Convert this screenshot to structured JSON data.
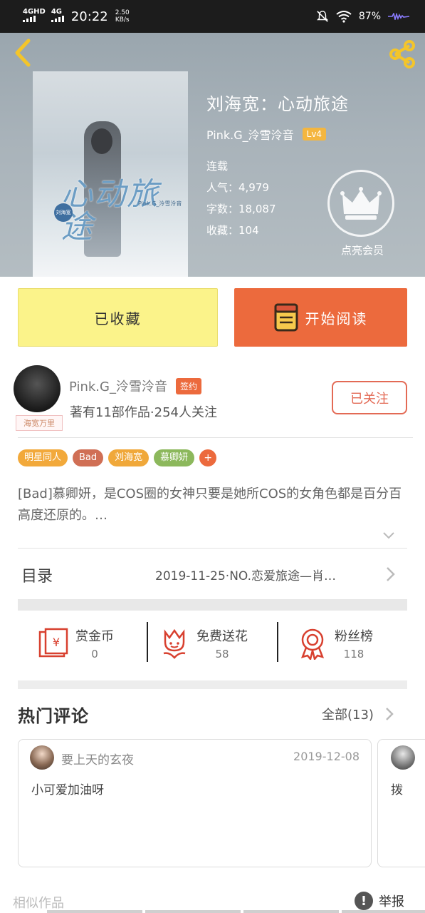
{
  "status_bar": {
    "signal1": "4GHD",
    "signal2": "4G",
    "time": "20:22",
    "net_speed_value": "2.50",
    "net_speed_unit": "KB/s",
    "battery": "87%"
  },
  "book": {
    "title": "刘海宽：心动旅途",
    "author": "Pink.G_泠雪泠音",
    "level": "Lv4",
    "status": "连载",
    "popularity": "人气：4,979",
    "word_count": "字数：18,087",
    "favorites": "收藏：104",
    "vip_label": "点亮会员",
    "cover_title": "心动旅途",
    "cover_author": "Pink.G_泠雪泠音",
    "cover_seal": "刘海宽"
  },
  "actions": {
    "collected_label": "已收藏",
    "read_label": "开始阅读"
  },
  "author_info": {
    "name": "Pink.G_泠雪泠音",
    "sign_badge": "签约",
    "subtitle": "著有11部作品·254人关注",
    "follow_label": "已关注",
    "avatar_tag": "海宽万里"
  },
  "tags": [
    {
      "label": "明星同人",
      "color": "#f2a93b"
    },
    {
      "label": "Bad",
      "color": "#d06f55"
    },
    {
      "label": "刘海宽",
      "color": "#f0a83a"
    },
    {
      "label": "慕卿妍",
      "color": "#8cb85c"
    }
  ],
  "tag_plus": "+",
  "synopsis": "[Bad]慕卿妍，是COS圈的女神只要是她所COS的女角色都是百分百高度还原的。…",
  "toc": {
    "label": "目录",
    "latest": "2019-11-25·NO.恋爱旅途—肖…"
  },
  "stats": [
    {
      "label": "赏金币",
      "value": "0"
    },
    {
      "label": "免费送花",
      "value": "58"
    },
    {
      "label": "粉丝榜",
      "value": "118"
    }
  ],
  "comments": {
    "title": "热门评论",
    "all_label": "全部(13)",
    "items": [
      {
        "user": "要上天的玄夜",
        "date": "2019-12-08",
        "text": "小可爱加油呀"
      },
      {
        "text": "拨"
      }
    ]
  },
  "footer": {
    "similar_label": "相似作品",
    "report_label": "举报",
    "report_icon": "!"
  },
  "colors": {
    "accent_orange": "#ec6a3d",
    "collected_yellow": "#fbf38a",
    "icon_red": "#d8402f",
    "share_yellow": "#f4c52a"
  }
}
